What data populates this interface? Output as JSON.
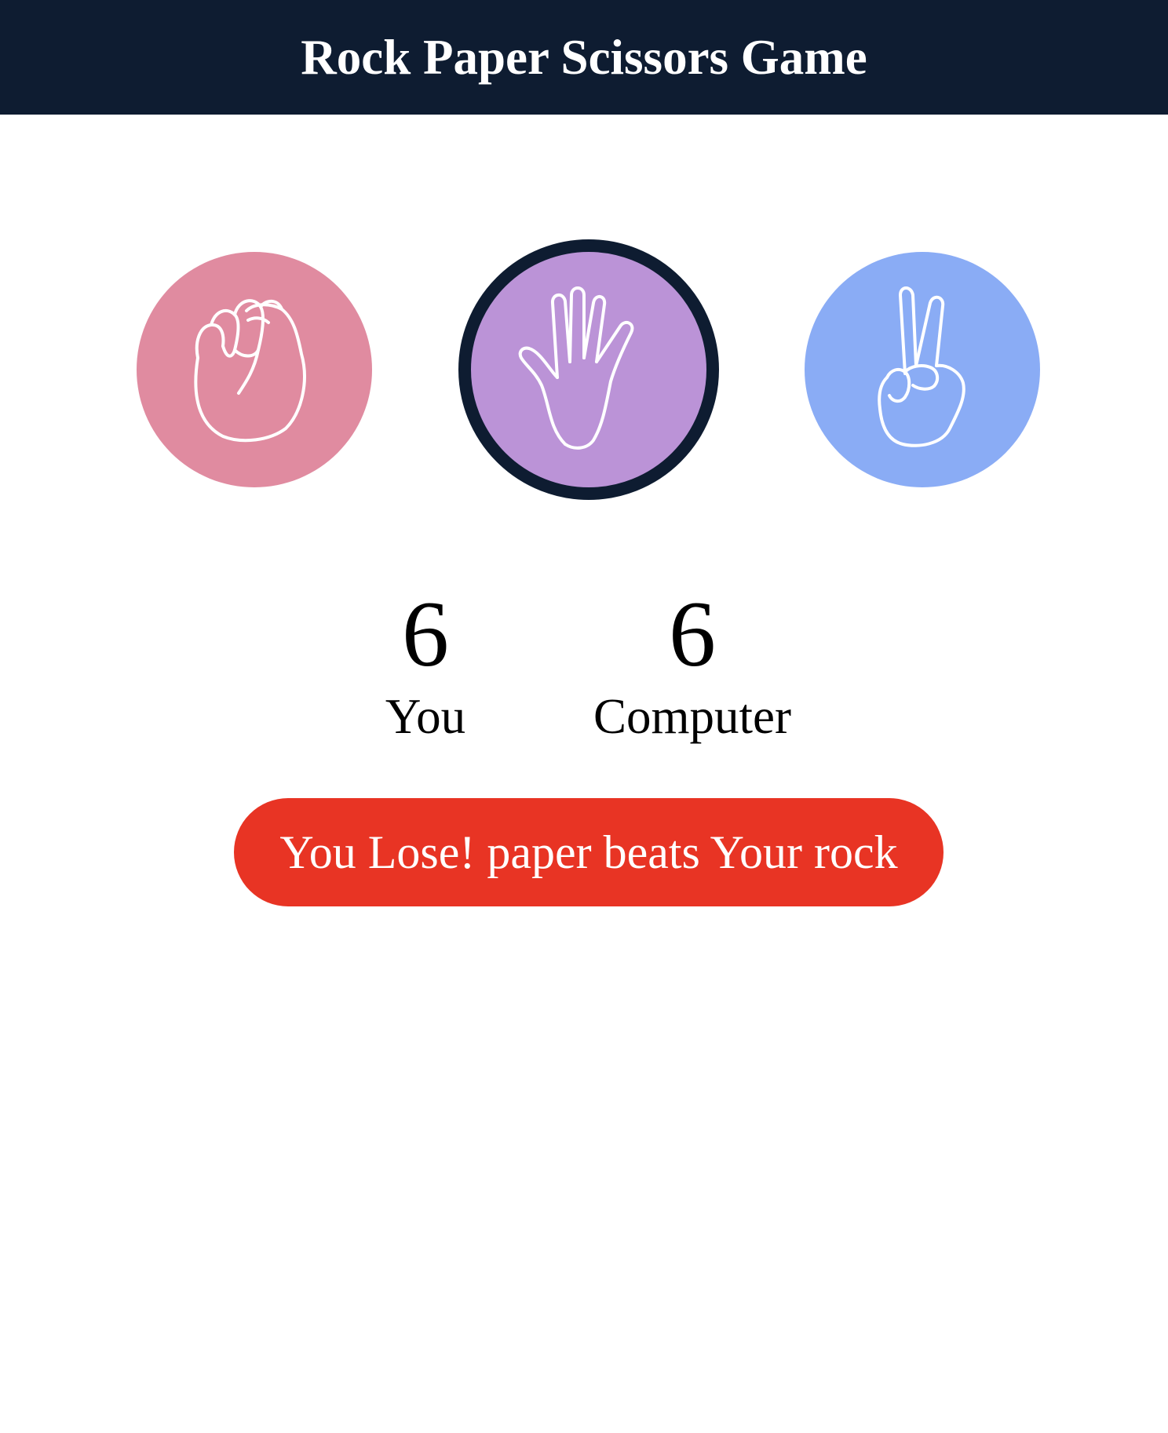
{
  "header": {
    "title": "Rock Paper Scissors Game",
    "background": "#0e1c31"
  },
  "choices": [
    {
      "name": "rock",
      "icon": "fist-icon",
      "color": "#e08ba0",
      "selected": false
    },
    {
      "name": "paper",
      "icon": "open-hand-icon",
      "color": "#bb93d7",
      "selected": true,
      "border_color": "#0e1c31"
    },
    {
      "name": "scissors",
      "icon": "peace-hand-icon",
      "color": "#8aacf5",
      "selected": false
    }
  ],
  "score": {
    "you": {
      "value": "6",
      "label": "You"
    },
    "computer": {
      "value": "6",
      "label": "Computer"
    }
  },
  "result": {
    "text": "You Lose! paper beats Your rock",
    "color": "#e83424"
  }
}
